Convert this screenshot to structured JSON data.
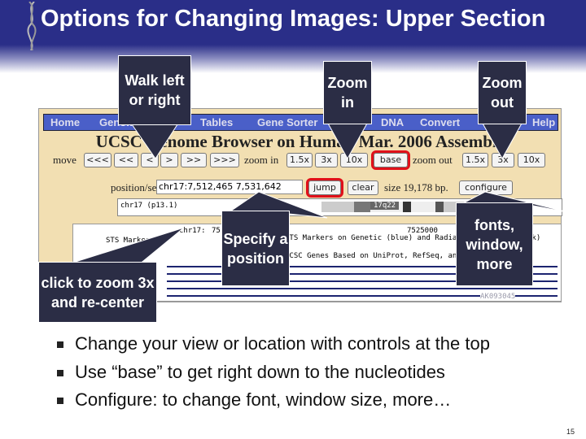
{
  "title": "Options for Changing Images: Upper Section",
  "browser": {
    "nav": [
      "Home",
      "Genomes",
      "Tables",
      "Gene Sorter",
      "DNA",
      "Convert",
      "Help"
    ],
    "heading": "UCSC Genome Browser on Human Mar. 2006 Assembly",
    "move_label": "move",
    "move_buttons": [
      "<<<",
      "<<",
      "<",
      ">",
      ">>",
      ">>>"
    ],
    "zoom_in_label": "zoom in",
    "zoom_in_buttons": [
      "1.5x",
      "3x",
      "10x",
      "base"
    ],
    "zoom_out_label": "zoom out",
    "zoom_out_buttons": [
      "1.5x",
      "3x",
      "10x"
    ],
    "position_label": "position/search",
    "position_value": "chr17:7,512,465 7,531,642",
    "jump": "jump",
    "clear": "clear",
    "size": "size 19,178 bp.",
    "configure": "configure",
    "ideogram_label": "chr17 (p13.1)",
    "band_label": "17q22",
    "track": {
      "chrom": "chr17:",
      "coord1": "7515000",
      "coord2": "7525000",
      "sts": "STS Markers",
      "sts_desc": "STS Markers on Genetic (blue) and Radiation Hybrid (black)",
      "genes_desc": "UCSC Genes Based on UniProt, RefSeq, and GenBank mRNA",
      "gene_id": "AK093045"
    }
  },
  "callouts": {
    "walk": "Walk left or right",
    "zoom_in": "Zoom in",
    "zoom_out": "Zoom out",
    "position": "Specify a position",
    "configure": "fonts, window, more",
    "click": "click to zoom 3x and re-center"
  },
  "bullets": [
    "Change your view or location with controls at the top",
    "Use “base” to get right down to the nucleotides",
    "Configure: to change font, window size, more…"
  ],
  "page_number": "15",
  "colors": {
    "header": "#2a2e88",
    "callout": "#2b2d45",
    "highlight": "#e0101a",
    "browser_bg": "#f2dfb2",
    "nav": "#4a5fc8"
  }
}
